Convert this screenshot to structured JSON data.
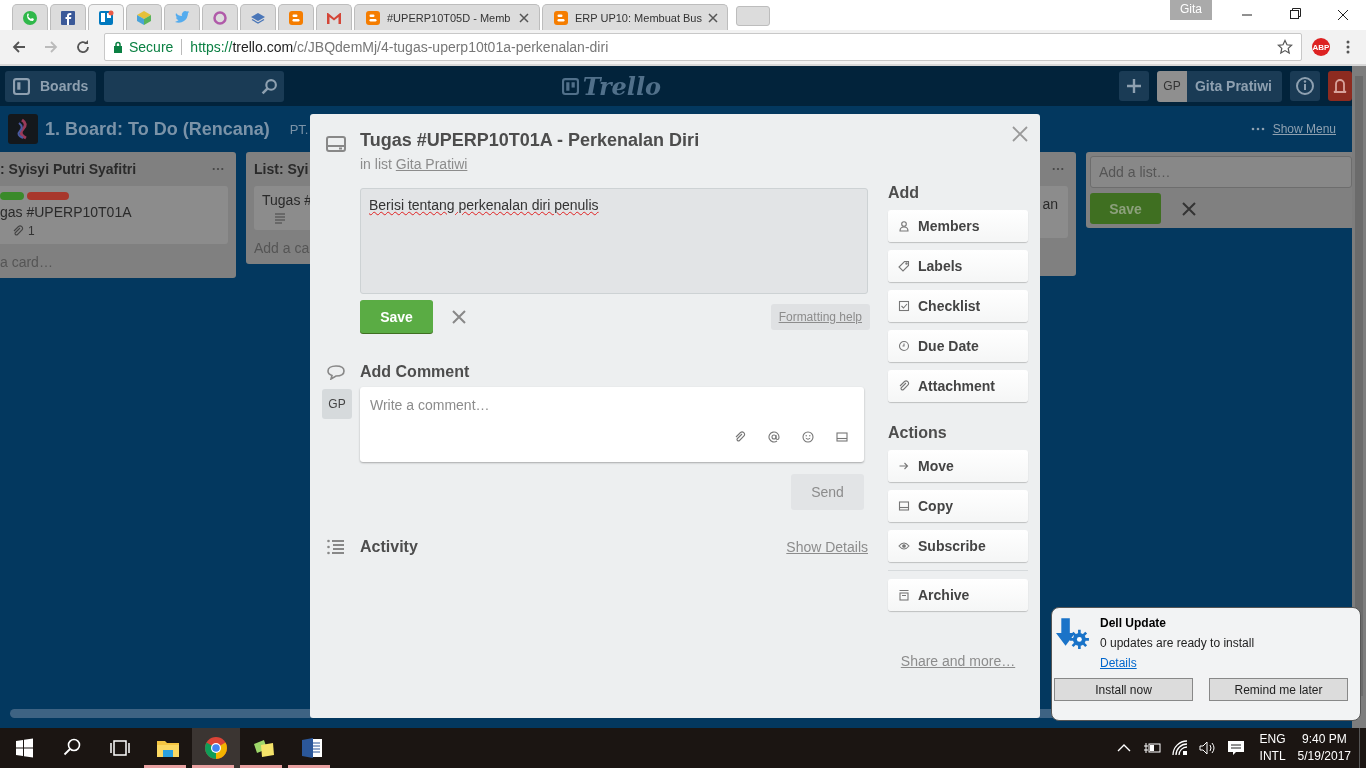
{
  "browser": {
    "tabs": [
      {
        "kind": "whatsapp",
        "selected": false
      },
      {
        "kind": "facebook",
        "selected": false
      },
      {
        "kind": "trello",
        "selected": true
      },
      {
        "kind": "cube",
        "selected": false
      },
      {
        "kind": "twitter",
        "selected": false
      },
      {
        "kind": "ring",
        "selected": false
      },
      {
        "kind": "stack",
        "selected": false
      },
      {
        "kind": "blogger",
        "selected": false
      },
      {
        "kind": "gmail",
        "selected": false
      },
      {
        "kind": "blogger",
        "title": "#UPERP10T05D - Memb",
        "selected": false
      },
      {
        "kind": "blogger",
        "title": "ERP UP10: Membuat Bus",
        "selected": false
      }
    ],
    "profile": "Gita",
    "address": {
      "secure_label": "Secure",
      "scheme": "https://",
      "host": "trello.com",
      "path": "/c/JBQdemMj/4-tugas-uperp10t01a-perkenalan-diri"
    },
    "extension": "ABP"
  },
  "header": {
    "boards_button": "Boards",
    "logo": "Trello",
    "avatar": "GP",
    "user_name": "Gita Pratiwi"
  },
  "board": {
    "title": "1. Board: To Do (Rencana)",
    "team": "PT.",
    "show_menu": "Show Menu",
    "lists": [
      {
        "title": ": Syisyi Putri Syafitri",
        "cards": [
          {
            "title": "gas #UPERP10T01A",
            "labels": [
              {
                "color": "#3a8a2a"
              },
              {
                "color": "#a8372c"
              }
            ],
            "attachments": "1",
            "has_description": false
          }
        ],
        "add_card": "a card…"
      },
      {
        "title": "List: Syi",
        "cards": [
          {
            "title": "Tugas #",
            "has_description": true
          }
        ],
        "add_card": "Add a ca"
      },
      {
        "cards": [
          {
            "title": "an",
            "has_description": false
          }
        ]
      }
    ],
    "add_list": {
      "placeholder": "Add a list…",
      "save": "Save"
    }
  },
  "card": {
    "title": "Tugas #UPERP10T01A - Perkenalan Diri",
    "list_prefix": "in list",
    "list_name": "Gita Pratiwi",
    "description": "Berisi tentang perkenalan diri penulis",
    "save": "Save",
    "formatting_help": "Formatting help",
    "comment_heading": "Add Comment",
    "avatar": "GP",
    "comment_placeholder": "Write a comment…",
    "send": "Send",
    "activity_heading": "Activity",
    "show_details": "Show Details",
    "add_heading": "Add",
    "add_buttons": [
      {
        "kind": "members",
        "label": "Members"
      },
      {
        "kind": "labels",
        "label": "Labels"
      },
      {
        "kind": "checklist",
        "label": "Checklist"
      },
      {
        "kind": "due",
        "label": "Due Date"
      },
      {
        "kind": "attachment",
        "label": "Attachment"
      }
    ],
    "actions_heading": "Actions",
    "action_buttons": [
      {
        "kind": "move",
        "label": "Move"
      },
      {
        "kind": "copy",
        "label": "Copy"
      },
      {
        "kind": "subscribe",
        "label": "Subscribe"
      },
      {
        "kind": "archive",
        "label": "Archive"
      }
    ],
    "share": "Share and more…"
  },
  "notification": {
    "title": "Dell Update",
    "body": "0 updates are ready to install",
    "link": "Details",
    "buttons": [
      "Install now",
      "Remind me later"
    ]
  },
  "taskbar": {
    "apps": [
      {
        "kind": "explorer",
        "running": true,
        "selected": false
      },
      {
        "kind": "chrome",
        "running": true,
        "selected": true
      },
      {
        "kind": "sticky",
        "running": true,
        "selected": false
      },
      {
        "kind": "word",
        "running": true,
        "selected": false
      }
    ],
    "language": "ENG",
    "layout": "INTL",
    "time": "9:40 PM",
    "date": "5/19/2017"
  }
}
